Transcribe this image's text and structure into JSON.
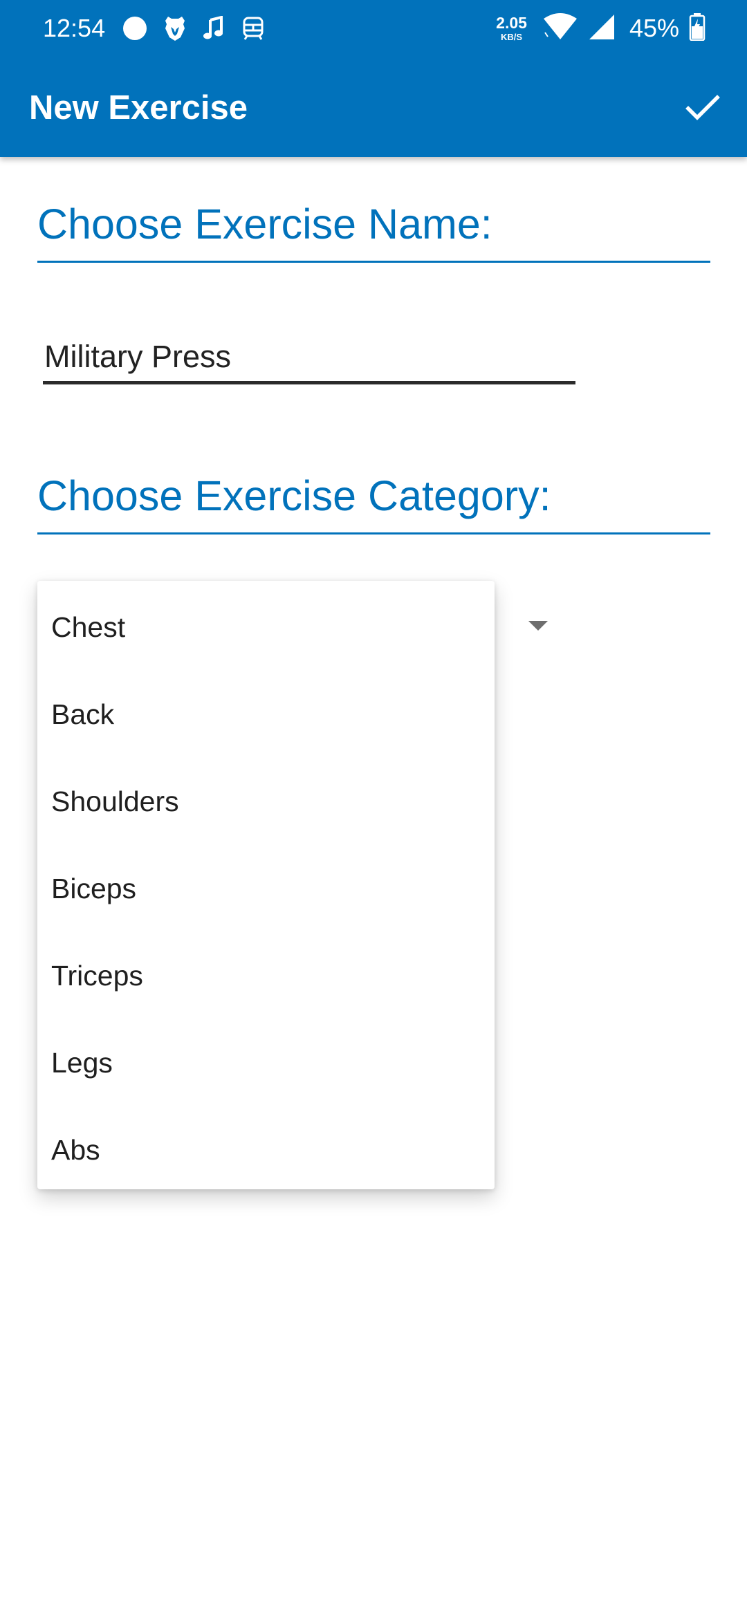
{
  "status_bar": {
    "time": "12:54",
    "left_icons": [
      "circle-notification-icon",
      "brave-lion-icon",
      "music-notes-icon",
      "transit-icon"
    ],
    "net_speed_value": "2.05",
    "net_speed_unit": "KB/S",
    "battery_percent": "45%",
    "right_icons": [
      "wifi-icon",
      "cellular-signal-icon",
      "battery-charging-icon"
    ]
  },
  "app_bar": {
    "title": "New Exercise",
    "confirm_icon": "checkmark-icon"
  },
  "form": {
    "name_heading": "Choose Exercise Name:",
    "name_value": "Military Press",
    "category_heading": "Choose Exercise Category:"
  },
  "dropdown": {
    "options": [
      "Chest",
      "Back",
      "Shoulders",
      "Biceps",
      "Triceps",
      "Legs",
      "Abs"
    ]
  },
  "colors": {
    "primary": "#0172bb",
    "background": "#ffffff",
    "text": "#1f1f1f"
  }
}
